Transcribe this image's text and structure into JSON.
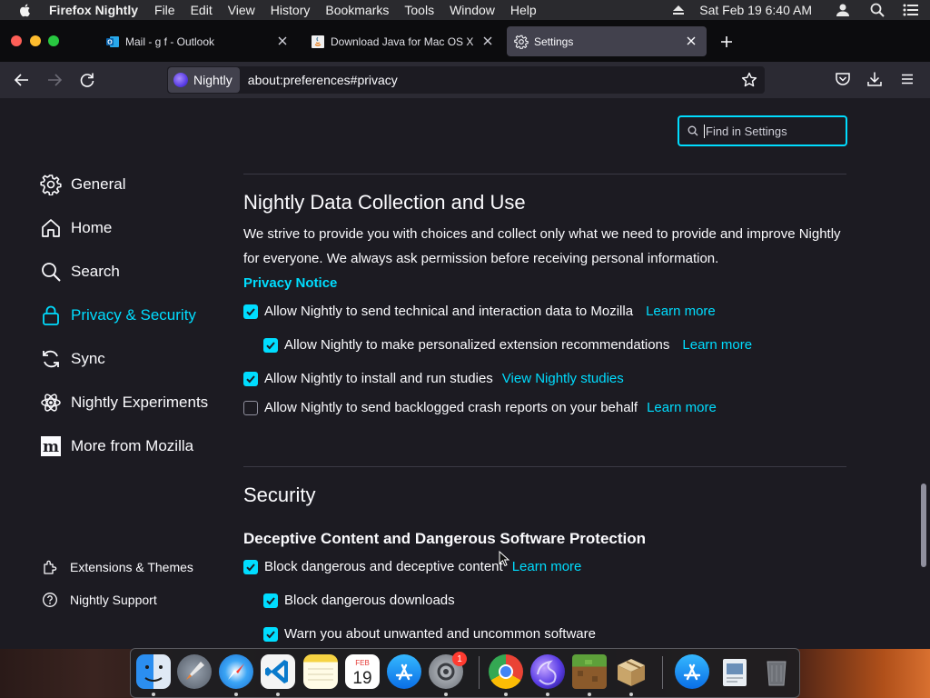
{
  "menubar": {
    "app_name": "Firefox Nightly",
    "items": [
      "File",
      "Edit",
      "View",
      "History",
      "Bookmarks",
      "Tools",
      "Window",
      "Help"
    ],
    "clock": "Sat Feb 19  6:40 AM"
  },
  "tabs": [
    {
      "title": "Mail - g f - Outlook",
      "icon": "outlook-icon",
      "active": false
    },
    {
      "title": "Download Java for Mac OS X",
      "icon": "java-icon",
      "active": false
    },
    {
      "title": "Settings",
      "icon": "gear-icon",
      "active": true
    }
  ],
  "navbar": {
    "identity_label": "Nightly",
    "url": "about:preferences#privacy"
  },
  "find": {
    "placeholder": "Find in Settings"
  },
  "sidebar": {
    "categories": [
      {
        "label": "General",
        "icon": "gear-icon",
        "selected": false
      },
      {
        "label": "Home",
        "icon": "home-icon",
        "selected": false
      },
      {
        "label": "Search",
        "icon": "search-icon",
        "selected": false
      },
      {
        "label": "Privacy & Security",
        "icon": "lock-icon",
        "selected": true
      },
      {
        "label": "Sync",
        "icon": "sync-icon",
        "selected": false
      },
      {
        "label": "Nightly Experiments",
        "icon": "experiments-icon",
        "selected": false
      },
      {
        "label": "More from Mozilla",
        "icon": "mozilla-icon",
        "selected": false
      }
    ],
    "footer": [
      {
        "label": "Extensions & Themes",
        "icon": "puzzle-icon"
      },
      {
        "label": "Nightly Support",
        "icon": "help-icon"
      }
    ]
  },
  "data_collection": {
    "heading": "Nightly Data Collection and Use",
    "description": "We strive to provide you with choices and collect only what we need to provide and improve Nightly for everyone. We always ask permission before receiving personal information.",
    "privacy_notice": "Privacy Notice",
    "options": [
      {
        "label": "Allow Nightly to send technical and interaction data to Mozilla",
        "checked": true,
        "link": "Learn more"
      },
      {
        "label": "Allow Nightly to make personalized extension recommendations",
        "checked": true,
        "link": "Learn more"
      },
      {
        "label": "Allow Nightly to install and run studies",
        "checked": true,
        "link": "View Nightly studies"
      },
      {
        "label": "Allow Nightly to send backlogged crash reports on your behalf",
        "checked": false,
        "link": "Learn more"
      }
    ]
  },
  "security": {
    "heading": "Security",
    "subheading": "Deceptive Content and Dangerous Software Protection",
    "options": [
      {
        "label": "Block dangerous and deceptive content",
        "checked": true,
        "link": "Learn more"
      },
      {
        "label": "Block dangerous downloads",
        "checked": true
      },
      {
        "label": "Warn you about unwanted and uncommon software",
        "checked": true
      }
    ]
  },
  "dock": {
    "apps": [
      "finder-icon",
      "launchpad-icon",
      "safari-icon",
      "vscode-icon",
      "notes-icon",
      "calendar-icon",
      "app-store-icon",
      "system-preferences-icon",
      "chrome-icon",
      "firefox-nightly-icon",
      "minecraft-icon",
      "installer-icon",
      "app-store-downloads-icon",
      "preview-icon",
      "trash-icon"
    ],
    "calendar_month": "FEB",
    "calendar_day": "19",
    "system_prefs_badge": "1"
  },
  "colors": {
    "accent": "#00ddff",
    "background": "#1c1b22",
    "toolbar": "#2b2a33"
  }
}
